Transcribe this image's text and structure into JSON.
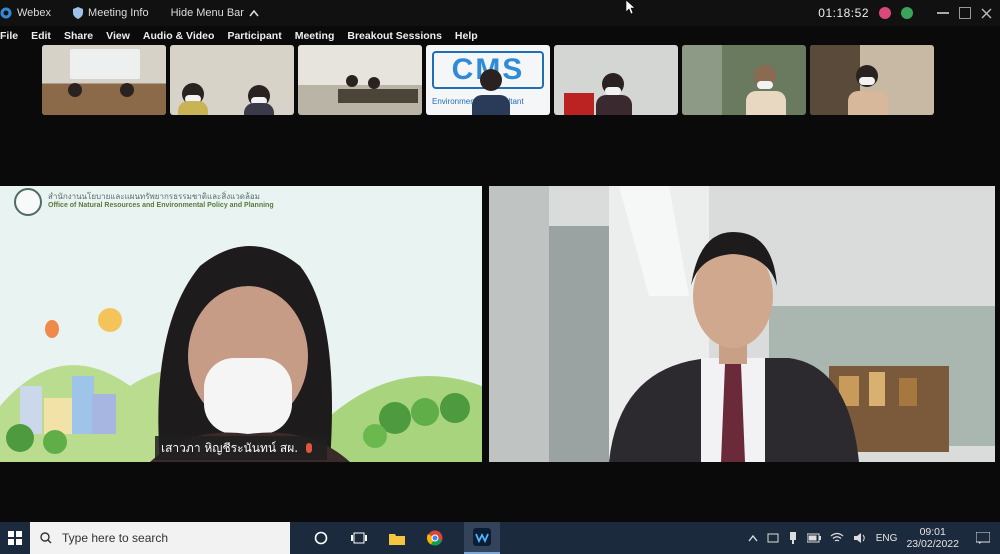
{
  "topbar": {
    "app_name": "Webex",
    "meeting_info": "Meeting Info",
    "hide_menu": "Hide Menu Bar",
    "timer": "01:18:52"
  },
  "menu": {
    "items": [
      "File",
      "Edit",
      "Share",
      "View",
      "Audio & Video",
      "Participant",
      "Meeting",
      "Breakout Sessions",
      "Help"
    ]
  },
  "thumbnails": {
    "cms_logo": "CMS",
    "cms_sub": "Environmental Consultant"
  },
  "left_tile": {
    "org_thai": "สำนักงานนโยบายและแผนทรัพยากรธรรมชาติและสิ่งแวดล้อม",
    "org_english": "Office of Natural Resources and Environmental Policy and Planning",
    "speaker_name": "เสาวภา หิญชีระนันทน์ สผ."
  },
  "taskbar": {
    "search_placeholder": "Type here to search",
    "language": "ENG",
    "time": "09:01",
    "date": "23/02/2022"
  },
  "colors": {
    "bg": "#0a0a0a",
    "taskbar": "#1b2a3c",
    "mic_muted": "#e0553b",
    "webex_accent": "#2f8bd6"
  }
}
